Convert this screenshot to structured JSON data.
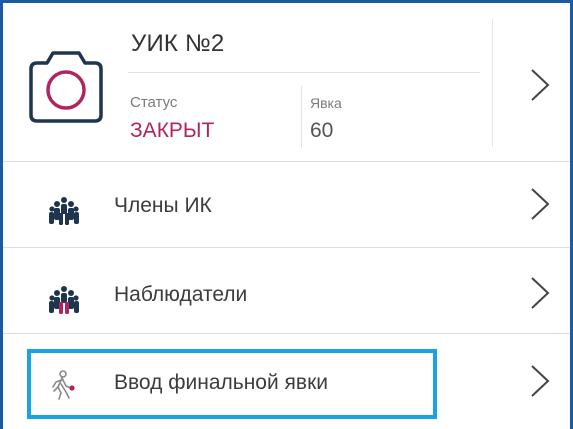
{
  "polling_station": {
    "title": "УИК №2",
    "status_label": "Статус",
    "status_value": "ЗАКРЫТ",
    "turnout_label": "Явка",
    "turnout_value": "60",
    "status_color": "#b2245f"
  },
  "menu": [
    {
      "label": "Члены ИК",
      "icon": "people-group-icon"
    },
    {
      "label": "Наблюдатели",
      "icon": "observers-group-icon"
    },
    {
      "label": "Ввод финальной явки",
      "icon": "walking-person-icon"
    }
  ],
  "colors": {
    "frame": "#1c5aa8",
    "highlight": "#1aa3e4",
    "accent": "#b2245f"
  }
}
